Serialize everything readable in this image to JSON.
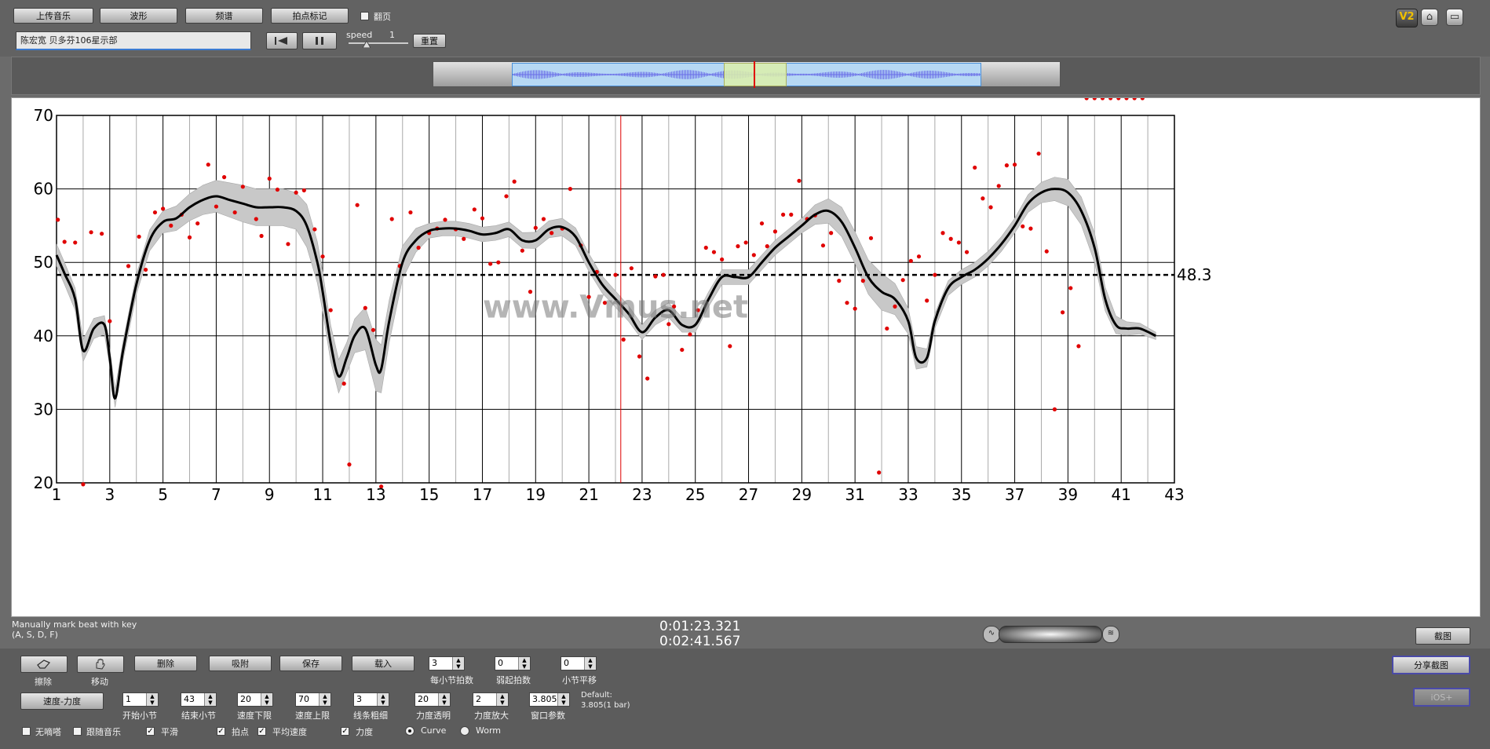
{
  "toolbar": {
    "upload": "上传音乐",
    "waveform": "波形",
    "spectrum": "频谱",
    "beat_mark": "拍点标记",
    "flip_page": "翻页",
    "track_title": "陈宏宽 贝多芬106星示部",
    "speed_label": "speed",
    "speed_value": "1",
    "reset": "重置",
    "logo": "V2"
  },
  "status": {
    "hint_line1": "Manually mark beat with key",
    "hint_line2": "(A, S, D, F)",
    "current_time": "0:01:23.321",
    "total_time": "0:02:41.567",
    "screenshot_btn": "截图",
    "share_btn": "分享截图",
    "disabled_btn": "iOS+"
  },
  "controls": {
    "erase": "擦除",
    "move": "移动",
    "delete": "删除",
    "snap": "吸附",
    "save": "保存",
    "load": "载入",
    "beats_per_bar_label": "每小节拍数",
    "beats_per_bar": "3",
    "pickup_label": "弱起拍数",
    "pickup": "0",
    "bar_shift_label": "小节平移",
    "bar_shift": "0",
    "tempo_dyn": "速度-力度",
    "start_bar_label": "开始小节",
    "start_bar": "1",
    "end_bar_label": "结束小节",
    "end_bar": "43",
    "tempo_low_label": "速度下限",
    "tempo_low": "20",
    "tempo_high_label": "速度上限",
    "tempo_high": "70",
    "line_width_label": "线条粗细",
    "line_width": "3",
    "dyn_opacity_label": "力度透明",
    "dyn_opacity": "20",
    "dyn_scale_label": "力度放大",
    "dyn_scale": "2",
    "window_param_label": "窗口参数",
    "window_param": "3.805",
    "default_label": "Default:",
    "default_value": "3.805(1 bar)",
    "no_metronome": "无嘀嗒",
    "follow_music": "跟随音乐",
    "smooth": "平滑",
    "beats": "拍点",
    "avg_tempo": "平均速度",
    "dynamics": "力度",
    "curve": "Curve",
    "worm": "Worm"
  },
  "chart_data": {
    "type": "line",
    "xlim": [
      1,
      43
    ],
    "ylim": [
      20,
      70
    ],
    "x_ticks": [
      "1",
      "3",
      "5",
      "7",
      "9",
      "11",
      "13",
      "15",
      "17",
      "19",
      "21",
      "23",
      "25",
      "27",
      "29",
      "31",
      "33",
      "35",
      "37",
      "39",
      "41",
      "43"
    ],
    "y_ticks": [
      "20",
      "30",
      "40",
      "50",
      "60",
      "70"
    ],
    "average_value": 48.3,
    "average_label": "48.3",
    "cursor_x": 22.2,
    "watermark": "www.Vmus.net",
    "curve": {
      "x": [
        1,
        1.3,
        1.7,
        2,
        2.4,
        2.8,
        3,
        3.2,
        3.5,
        4,
        4.5,
        5,
        5.5,
        6,
        6.5,
        7,
        7.5,
        8,
        8.5,
        9,
        9.5,
        10,
        10.4,
        10.8,
        11,
        11.3,
        11.6,
        11.9,
        12.2,
        12.6,
        13,
        13.2,
        13.5,
        14,
        14.5,
        15,
        15.5,
        16,
        16.5,
        17,
        17.5,
        18,
        18.5,
        19,
        19.5,
        20,
        20.5,
        21,
        21.5,
        22,
        22.5,
        23,
        23.5,
        24,
        24.5,
        25,
        25.5,
        26,
        26.5,
        27,
        27.5,
        28,
        28.5,
        29,
        29.5,
        30,
        30.5,
        31,
        31.5,
        32,
        32.5,
        33,
        33.3,
        33.7,
        34,
        34.5,
        35,
        35.5,
        36,
        36.5,
        37,
        37.5,
        38,
        38.5,
        39,
        39.5,
        40,
        40.4,
        40.8,
        41.2,
        41.7,
        42.3
      ],
      "y": [
        51,
        48.5,
        45,
        38,
        41,
        41.5,
        37,
        31.5,
        38,
        47,
        53,
        55.5,
        56,
        57.5,
        58.5,
        59,
        58.5,
        58,
        57.5,
        57.5,
        57.5,
        57,
        55,
        50,
        46,
        39,
        34.5,
        37,
        40,
        41,
        36,
        35.5,
        42,
        50,
        53,
        54.3,
        54.6,
        54.6,
        54.3,
        53.8,
        54,
        54.5,
        53,
        53,
        54.5,
        54.8,
        53.5,
        50,
        47,
        45,
        43,
        40.5,
        42.5,
        43.5,
        41.5,
        41.5,
        45,
        48,
        48,
        48,
        50,
        52,
        53.5,
        55,
        56.5,
        57,
        55.5,
        52,
        48,
        46,
        45,
        42,
        37,
        37,
        42,
        46.5,
        48,
        49,
        50.5,
        52.5,
        55,
        58,
        59.5,
        60,
        59.5,
        57,
        52,
        45,
        41.5,
        41,
        41,
        40
      ]
    },
    "band_halfwidth": {
      "x": [
        1,
        2,
        3,
        5,
        8,
        10,
        10.5,
        12,
        13,
        15,
        18,
        20,
        21,
        23,
        26,
        29,
        30.5,
        32,
        34,
        37,
        39,
        40,
        41,
        42.3
      ],
      "y": [
        1.5,
        1.5,
        1.2,
        1.5,
        2.5,
        2.5,
        3,
        2,
        3.5,
        1,
        1,
        1.2,
        1.2,
        1,
        1,
        1,
        2,
        2.5,
        1,
        1,
        1.8,
        2,
        1,
        0.5
      ]
    },
    "scatter": {
      "x": [
        1.05,
        1.3,
        1.7,
        2,
        2.3,
        2.7,
        3,
        3.7,
        4.1,
        4.35,
        4.7,
        5,
        5.3,
        5.7,
        6,
        6.3,
        6.7,
        7,
        7.3,
        7.7,
        8,
        8.5,
        8.7,
        9,
        9.3,
        9.7,
        10,
        10.3,
        10.7,
        11,
        11.3,
        11.8,
        12,
        12.3,
        12.6,
        12.9,
        13.2,
        13.6,
        13.9,
        14.3,
        14.6,
        15,
        15.3,
        15.6,
        16,
        16.3,
        16.7,
        17,
        17.3,
        17.6,
        17.9,
        18.2,
        18.5,
        18.8,
        19,
        19.3,
        19.6,
        20,
        20.3,
        20.7,
        21,
        21.3,
        21.6,
        22,
        22.3,
        22.6,
        22.9,
        23.2,
        23.5,
        23.8,
        24,
        24.2,
        24.5,
        24.8,
        25.1,
        25.4,
        25.7,
        26,
        26.3,
        26.6,
        26.9,
        27.2,
        27.5,
        27.7,
        28,
        28.3,
        28.6,
        28.9,
        29.2,
        29.5,
        29.8,
        30.1,
        30.4,
        30.7,
        31,
        31.3,
        31.6,
        31.9,
        32.2,
        32.5,
        32.8,
        33.1,
        33.4,
        33.7,
        34,
        34.3,
        34.6,
        34.9,
        35.2,
        35.5,
        35.8,
        36.1,
        36.4,
        36.7,
        37,
        37.3,
        37.6,
        37.9,
        38.2,
        38.5,
        38.8,
        39.1,
        39.4,
        39.7,
        40,
        40.3,
        40.6,
        40.9,
        41.2,
        41.5,
        41.8
      ],
      "y": [
        55.8,
        52.8,
        52.7,
        19.8,
        54.1,
        53.9,
        42,
        49.5,
        53.5,
        49,
        56.8,
        57.3,
        55,
        56.5,
        53.4,
        55.3,
        63.3,
        57.6,
        61.6,
        56.8,
        60.3,
        55.9,
        53.6,
        61.4,
        59.9,
        52.5,
        59.5,
        59.8,
        54.5,
        50.8,
        43.5,
        33.5,
        22.5,
        57.8,
        43.8,
        40.8,
        19.5,
        55.9,
        49.5,
        56.8,
        52,
        54,
        54.6,
        55.8,
        54.5,
        53.2,
        57.2,
        56,
        49.8,
        50,
        59,
        61,
        51.6,
        46,
        54.7,
        55.9,
        54,
        54.6,
        60,
        52.3,
        45.3,
        48.7,
        44.5,
        48.3,
        39.5,
        49.2,
        37.2,
        34.2,
        48.1,
        48.3,
        41.6,
        44,
        38.1,
        40.2,
        43.5,
        52,
        51.4,
        50.4,
        38.6,
        52.2,
        52.7,
        51,
        55.3,
        52.2,
        54.2,
        56.5,
        56.5,
        61.1,
        55.9,
        56.4,
        52.3,
        54,
        47.5,
        44.5,
        43.7,
        47.5,
        53.3,
        21.4,
        41,
        44,
        47.6,
        50.2,
        50.8,
        44.8,
        48.3,
        54,
        53.2,
        52.7,
        51.4,
        62.9,
        58.7,
        57.5,
        60.4,
        63.2,
        63.3,
        54.9,
        54.6,
        64.8,
        51.5,
        30,
        43.2,
        46.5,
        38.6
      ]
    }
  }
}
